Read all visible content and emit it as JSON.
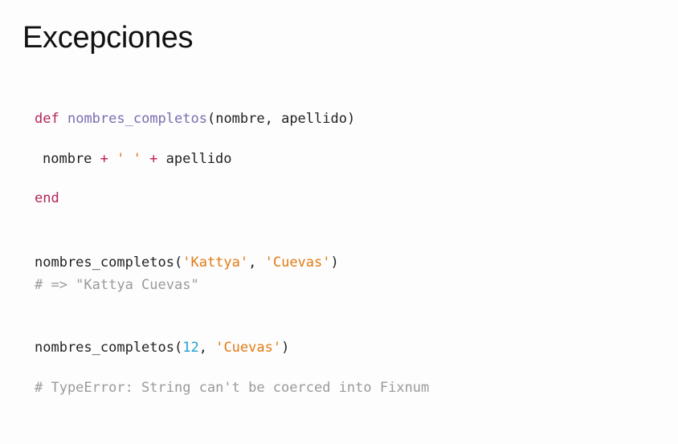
{
  "slide": {
    "title": "Excepciones"
  },
  "code": {
    "line1": {
      "keyword": "def",
      "name": "nombres_completos",
      "params": "(nombre, apellido)"
    },
    "line2": {
      "a": "nombre",
      "plus1": "+",
      "space_str": "' '",
      "plus2": "+",
      "b": "apellido"
    },
    "line3": {
      "keyword": "end"
    },
    "call1": {
      "name": "nombres_completos(",
      "arg1": "'Kattya'",
      "sep": ", ",
      "arg2": "'Cuevas'",
      "close": ")"
    },
    "result1": "# => \"Kattya Cuevas\"",
    "call2": {
      "name": "nombres_completos(",
      "arg1": "12",
      "sep": ", ",
      "arg2": "'Cuevas'",
      "close": ")"
    },
    "result2": "# TypeError: String can't be coerced into Fixnum"
  },
  "colors": {
    "keyword": "#b3245a",
    "function_name": "#7b6bb0",
    "string": "#e07b14",
    "number": "#1f9fd0",
    "comment": "#9a9a9a"
  }
}
